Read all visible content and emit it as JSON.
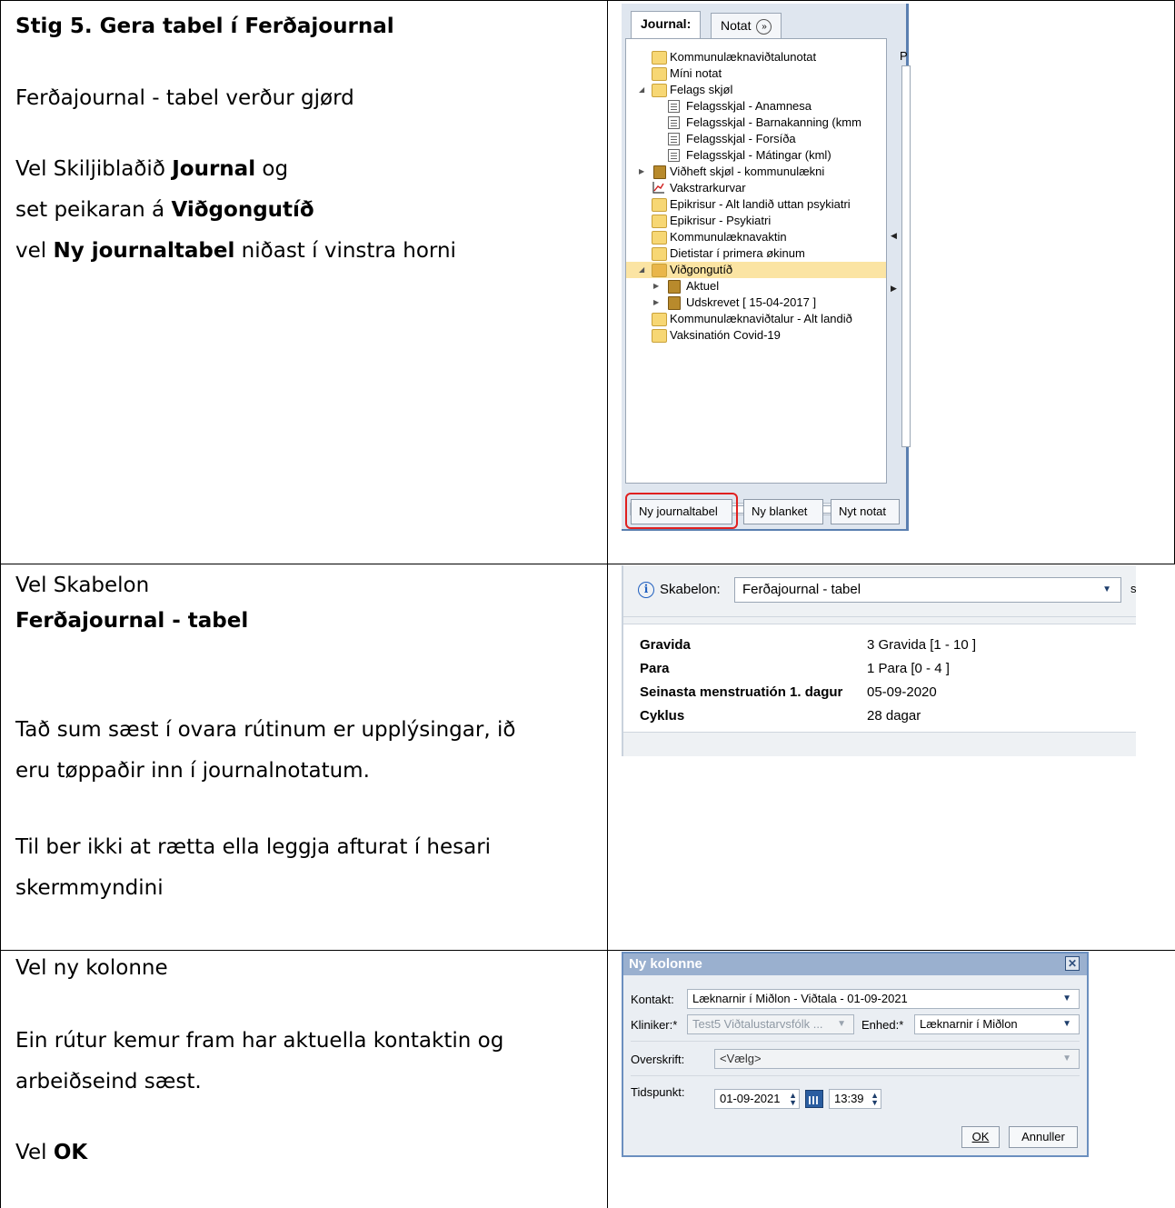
{
  "rows": [
    {
      "lines": [
        {
          "segments": [
            {
              "text": "Stig 5. Gera tabel í Ferðajournal",
              "bold": true
            }
          ]
        },
        {
          "segments": [
            {
              "text": "Ferðajournal - tabel verður gjørd",
              "bold": false
            }
          ]
        },
        {
          "segments": [
            {
              "text": "Vel Skiljiblaðið ",
              "bold": false
            },
            {
              "text": "Journal",
              "bold": true
            },
            {
              "text": " og",
              "bold": false
            }
          ]
        },
        {
          "segments": [
            {
              "text": "set peikaran á ",
              "bold": false
            },
            {
              "text": "Viðgongutíð",
              "bold": true
            }
          ]
        },
        {
          "segments": [
            {
              "text": "vel ",
              "bold": false
            },
            {
              "text": "Ny journaltabel",
              "bold": true
            },
            {
              "text": " niðast í vinstra horni",
              "bold": false
            }
          ]
        }
      ]
    },
    {
      "lines": [
        {
          "segments": [
            {
              "text": "Vel Skabelon",
              "bold": false
            }
          ]
        },
        {
          "segments": [
            {
              "text": "Ferðajournal - tabel",
              "bold": true
            }
          ]
        },
        {
          "segments": [
            {
              "text": "Tað sum sæst í ovara rútinum er upplýsingar, ið",
              "bold": false
            }
          ]
        },
        {
          "segments": [
            {
              "text": "eru tøppaðir inn í journalnotatum.",
              "bold": false
            }
          ]
        },
        {
          "segments": [
            {
              "text": "Til ber ikki at rætta ella leggja afturat í hesari",
              "bold": false
            }
          ]
        },
        {
          "segments": [
            {
              "text": "skermmyndini",
              "bold": false
            }
          ]
        }
      ]
    },
    {
      "lines": [
        {
          "segments": [
            {
              "text": "Vel ny kolonne",
              "bold": false
            }
          ]
        },
        {
          "segments": [
            {
              "text": "Ein rútur kemur fram har aktuella kontaktin og",
              "bold": false
            }
          ]
        },
        {
          "segments": [
            {
              "text": "arbeiðseind sæst.",
              "bold": false
            }
          ]
        },
        {
          "segments": [
            {
              "text": "Vel ",
              "bold": false
            },
            {
              "text": "OK",
              "bold": true
            }
          ]
        }
      ]
    }
  ],
  "journal_panel": {
    "tabs": {
      "journal": "Journal:",
      "notat": "Notat"
    },
    "tree": [
      {
        "label": "Kommunulæknaviðtalunotat",
        "icon": "folder-icon"
      },
      {
        "label": "Míni notat",
        "icon": "folder-icon"
      },
      {
        "label": "Felags skjøl",
        "icon": "folder-icon"
      },
      {
        "label": "Felagsskjal - Anamnesa",
        "icon": "document-icon"
      },
      {
        "label": "Felagsskjal - Barnakanning (kmm",
        "icon": "document-icon"
      },
      {
        "label": "Felagsskjal - Forsíða",
        "icon": "document-icon"
      },
      {
        "label": "Felagsskjal - Mátingar (kml)",
        "icon": "document-icon"
      },
      {
        "label": "Viðheft skjøl - kommunulækni",
        "icon": "book-icon"
      },
      {
        "label": "Vakstrarkurvar",
        "icon": "chart-icon"
      },
      {
        "label": "Epikrisur - Alt landið uttan psykiatri",
        "icon": "folder-icon"
      },
      {
        "label": "Epikrisur - Psykiatri",
        "icon": "folder-icon"
      },
      {
        "label": "Kommunulæknavaktin",
        "icon": "folder-icon"
      },
      {
        "label": "Dietistar í primera økinum",
        "icon": "folder-icon"
      },
      {
        "label": "Viðgongutíð",
        "icon": "pregnancy-folder-icon"
      },
      {
        "label": "Aktuel",
        "icon": "book-icon"
      },
      {
        "label": "Udskrevet [ 15-04-2017 ]",
        "icon": "book-icon"
      },
      {
        "label": "Kommunulæknaviðtalur - Alt landið",
        "icon": "folder-icon"
      },
      {
        "label": "Vaksinatión Covid-19",
        "icon": "folder-icon"
      }
    ],
    "side_letter": "P",
    "buttons": {
      "ny_journaltabel": "Ny journaltabel",
      "ny_blanket": "Ny blanket",
      "nyt_notat": "Nyt notat"
    },
    "highlight_color": "#e02020",
    "selection_color": "#fbe4a3"
  },
  "skabelon_panel": {
    "label": "Skabelon:",
    "selected": "Ferðajournal - tabel",
    "info_glyph": "i",
    "side_letter": "s",
    "rows": [
      {
        "key": "Gravida",
        "value": "3 Gravida [1 - 10 ]"
      },
      {
        "key": "Para",
        "value": "1 Para [0 - 4 ]"
      },
      {
        "key": "Seinasta menstruatión 1. dagur",
        "value": "05-09-2020"
      },
      {
        "key": "Cyklus",
        "value": "28 dagar"
      }
    ]
  },
  "ny_kolonne_dialog": {
    "title": "Ny kolonne",
    "close_glyph": "✕",
    "kontakt_label": "Kontakt:",
    "kontakt_value": "Læknarnir í Miðlon - Viðtala -  01-09-2021",
    "kliniker_label": "Kliniker:*",
    "kliniker_value": "Test5 Viðtalustarvsfólk ...",
    "enhed_label": "Enhed:*",
    "enhed_value": "Læknarnir í Miðlon",
    "overskrift_label": "Overskrift:",
    "overskrift_value": "<Vælg>",
    "tidspunkt_label": "Tidspunkt:",
    "date_value": "01-09-2021",
    "time_value": "13:39",
    "ok_label": "OK",
    "annuller_label": "Annuller"
  }
}
